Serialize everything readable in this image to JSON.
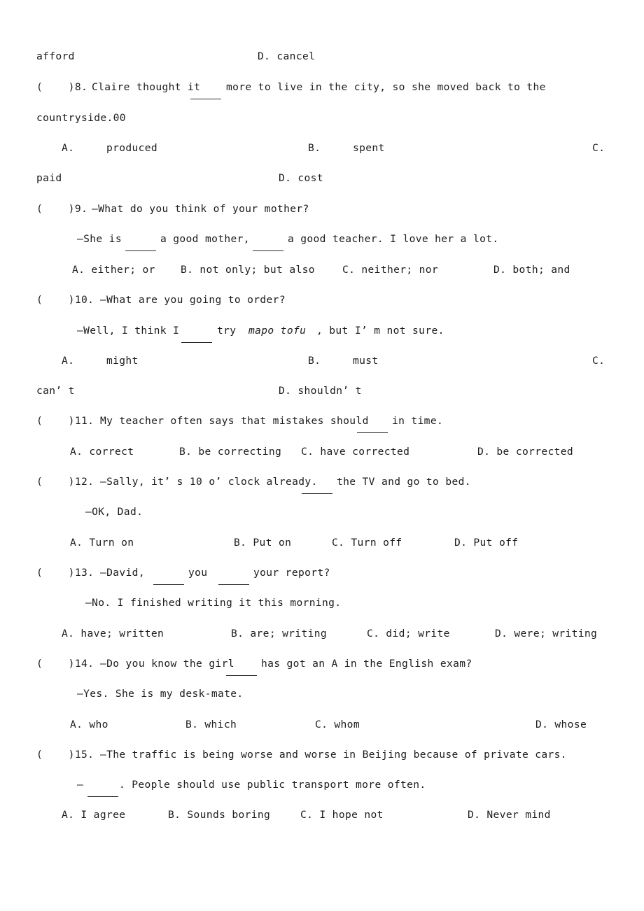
{
  "document": {
    "type": "english-grammar-worksheet",
    "page_background": "#ffffff",
    "text_color": "#1c1c1c"
  },
  "lines": {
    "q7_cont_left": "afford",
    "q7_cont_d": "D. cancel",
    "q8_marker": "(    )8.",
    "q8_stem_a": "Claire thought it",
    "q8_stem_b": "more to live in the city, so she moved back to the",
    "q8_wrap": "countryside.00",
    "q8_opt_a": "A.     produced",
    "q8_opt_b": "B.     spent",
    "q8_opt_c": "C.",
    "q8_opt_c_wrap": "paid",
    "q8_opt_d": "D. cost",
    "q9_marker": "(    )9.",
    "q9_stem": "—What do you think of your mother?",
    "q9_reply_a": "—She is",
    "q9_reply_b": "a good mother,",
    "q9_reply_c": "a good teacher. I love her a lot.",
    "q9_opt_a": "A. either; or",
    "q9_opt_b": "B. not only; but also",
    "q9_opt_c": "C. neither; nor",
    "q9_opt_d": "D. both; and",
    "q10_marker": "(    )10.",
    "q10_stem": "—What are you going to order?",
    "q10_reply_a": "—Well, I think I",
    "q10_reply_b": "try",
    "q10_reply_italic": "mapo tofu",
    "q10_reply_c": ", but I’ m not sure.",
    "q10_opt_a": "A.     might",
    "q10_opt_b": "B.     must",
    "q10_opt_c": "C.",
    "q10_opt_c_wrap": "can’ t",
    "q10_opt_d": "D. shouldn’ t",
    "q11_marker": "(    )11.",
    "q11_stem_a": "My teacher often says that mistakes should",
    "q11_stem_b": "in time.",
    "q11_opt_a": "A. correct",
    "q11_opt_b": "B. be correcting",
    "q11_opt_c": "C. have corrected",
    "q11_opt_d": "D. be corrected",
    "q12_marker": "(    )12.",
    "q12_stem_a": "—Sally, it’ s 10 o’ clock already.",
    "q12_stem_b": "the TV and go to bed.",
    "q12_reply": "—OK, Dad.",
    "q12_opt_a": "A. Turn on",
    "q12_opt_b": "B. Put on",
    "q12_opt_c": "C. Turn off",
    "q12_opt_d": "D. Put off",
    "q13_marker": "(    )13.",
    "q13_stem_a": "—David,",
    "q13_stem_b": "you",
    "q13_stem_c": "your report?",
    "q13_reply": "—No. I finished writing it this morning.",
    "q13_opt_a": "A. have; written",
    "q13_opt_b": "B. are; writing",
    "q13_opt_c": "C. did; write",
    "q13_opt_d": "D. were; writing",
    "q14_marker": "(    )14.",
    "q14_stem_a": "—Do you know the girl",
    "q14_stem_b": "has got an A in the English exam?",
    "q14_reply": "—Yes. She is my desk-mate.",
    "q14_opt_a": "A. who",
    "q14_opt_b": "B. which",
    "q14_opt_c": "C. whom",
    "q14_opt_d": "D. whose",
    "q15_marker": "(    )15.",
    "q15_stem": "—The traffic is being worse and worse in Beijing because of private cars.",
    "q15_reply_a": "—",
    "q15_reply_b": ". People should use public transport more often.",
    "q15_opt_a": "A. I agree",
    "q15_opt_b": "B. Sounds boring",
    "q15_opt_c": "C. I hope not",
    "q15_opt_d": "D. Never mind"
  }
}
